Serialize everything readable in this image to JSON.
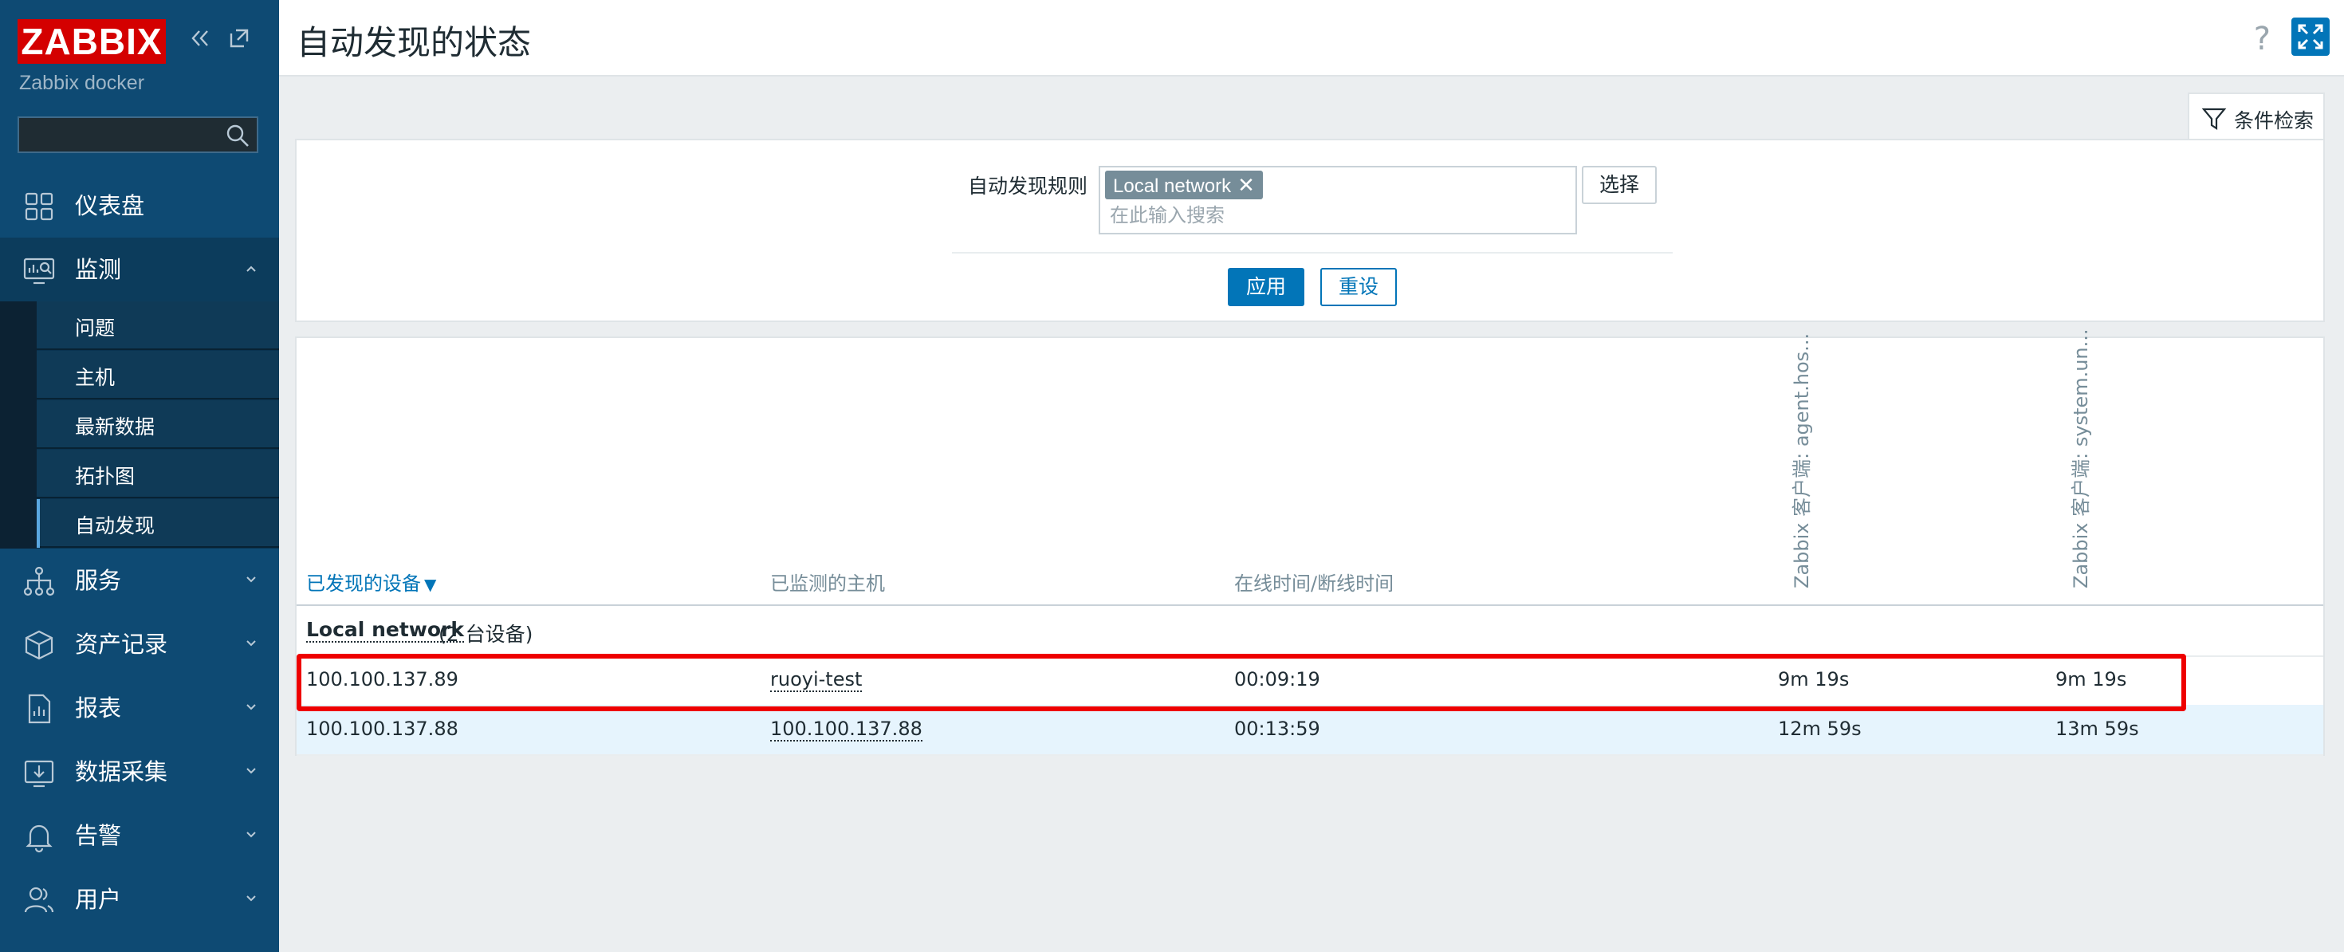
{
  "sidebar": {
    "logo": "ZABBIX",
    "server_name": "Zabbix docker",
    "search_value": "",
    "colors": {
      "background": "#0e4a73",
      "logo": "#d40000"
    },
    "menu": [
      {
        "label": "仪表盘",
        "icon": "dashboard-icon"
      },
      {
        "label": "监测",
        "icon": "monitoring-icon",
        "open": true
      },
      {
        "label": "服务",
        "icon": "services-icon"
      },
      {
        "label": "资产记录",
        "icon": "inventory-icon"
      },
      {
        "label": "报表",
        "icon": "reports-icon"
      },
      {
        "label": "数据采集",
        "icon": "data-collection-icon"
      },
      {
        "label": "告警",
        "icon": "alerts-icon"
      },
      {
        "label": "用户",
        "icon": "users-icon"
      }
    ],
    "submenu": [
      "问题",
      "主机",
      "最新数据",
      "拓扑图",
      "自动发现"
    ],
    "selected_submenu": "自动发现"
  },
  "header": {
    "title": "自动发现的状态",
    "help": "?"
  },
  "filter": {
    "tab_label": "条件检索",
    "rule_label": "自动发现规则",
    "selected_rule": "Local network",
    "remove_glyph": "✕",
    "search_placeholder": "在此输入搜索",
    "select_label": "选择",
    "apply_label": "应用",
    "reset_label": "重设",
    "accent_color": "#0275b8"
  },
  "table": {
    "columns": {
      "device": "已发现的设备",
      "host": "已监测的主机",
      "uptime": "在线时间/断线时间",
      "check1": "Zabbix 客户端: agent.hos...",
      "check2": "Zabbix 客户端: system.un..."
    },
    "sort_arrow": "▼",
    "group": {
      "name": "Local network",
      "count": "(2 台设备)"
    },
    "rows": [
      {
        "device": "100.100.137.89",
        "host": "ruoyi-test",
        "uptime": "00:09:19",
        "check1": "9m 19s",
        "check2": "9m 19s"
      },
      {
        "device": "100.100.137.88",
        "host": "100.100.137.88",
        "uptime": "00:13:59",
        "check1": "12m 59s",
        "check2": "13m 59s"
      }
    ]
  },
  "annotation": {
    "highlight_color": "#ee0000"
  }
}
